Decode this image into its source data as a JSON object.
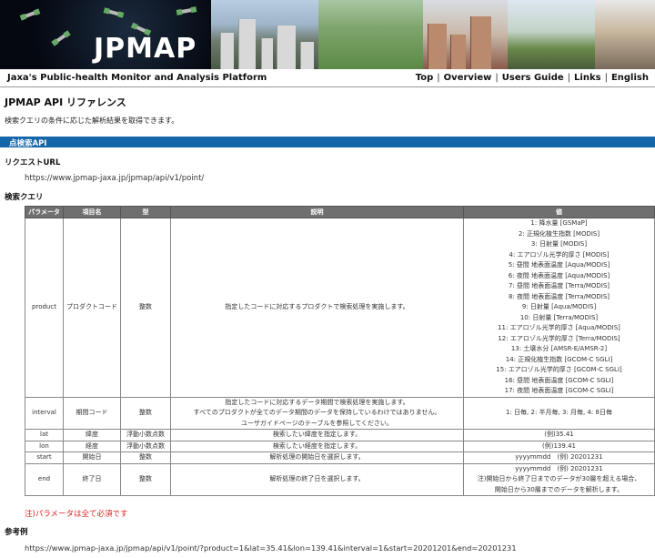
{
  "banner": {
    "logo_text": "JPMAP"
  },
  "header": {
    "subtitle": "Jaxa's Public-health Monitor and Analysis Platform",
    "nav": [
      "Top",
      "Overview",
      "Users Guide",
      "Links",
      "English"
    ]
  },
  "page": {
    "title": "JPMAP API リファレンス",
    "description": "検索クエリの条件に応じた解析結果を取得できます。"
  },
  "section": {
    "title": "点検索API",
    "request_url_heading": "リクエストURL",
    "request_url": "https://www.jpmap-jaxa.jp/jpmap/api/v1/point/",
    "query_heading": "検索クエリ"
  },
  "table": {
    "headers": [
      "パラメータ",
      "項目名",
      "型",
      "説明",
      "値"
    ],
    "product": {
      "param": "product",
      "name": "プロダクトコード",
      "type": "整数",
      "desc": "指定したコードに対応するプロダクトで検索処理を実施します。",
      "values": [
        "1: 降水量 [GSMaP]",
        "2: 正規化植生指数 [MODIS]",
        "3: 日射量 [MODIS]",
        "4: エアロゾル光学的厚さ [MODIS]",
        "5: 昼間 地表面温度 [Aqua/MODIS]",
        "6: 夜間 地表面温度 [Aqua/MODIS]",
        "7: 昼間 地表面温度 [Terra/MODIS]",
        "8: 夜間 地表面温度 [Terra/MODIS]",
        "9: 日射量 [Aqua/MODIS]",
        "10: 日射量 [Terra/MODIS]",
        "11: エアロゾル光学的厚さ [Aqua/MODIS]",
        "12: エアロゾル光学的厚さ [Terra/MODIS]",
        "13: 土壌水分 [AMSR-E/AMSR-2]",
        "14: 正規化植生指数 [GCOM-C SGLI]",
        "15: エアロゾル光学的厚さ [GCOM-C SGLI]",
        "16: 昼間 地表面温度 [GCOM-C SGLI]",
        "17: 夜間 地表面温度 [GCOM-C SGLI]"
      ]
    },
    "interval": {
      "param": "interval",
      "name": "期間コード",
      "type": "整数",
      "desc_lines": [
        "指定したコードに対応するデータ期間で検索処理を実施します。",
        "すべてのプロダクトが全てのデータ期間のデータを保持しているわけではありません。",
        "ユーザガイドページのテーブルを参照してください。"
      ],
      "value": "1: 日毎, 2: 半月毎, 3: 月毎, 4: 8日毎"
    },
    "lat": {
      "param": "lat",
      "name": "緯度",
      "type": "浮動小数点数",
      "desc": "検索したい緯度を指定します。",
      "value": "(例)35.41"
    },
    "lon": {
      "param": "lon",
      "name": "経度",
      "type": "浮動小数点数",
      "desc": "検索したい経度を指定します。",
      "value": "(例)139.41"
    },
    "start": {
      "param": "start",
      "name": "開始日",
      "type": "整数",
      "desc": "解析処理の開始日を選択します。",
      "value": "yyyymmdd　(例) 20201231"
    },
    "end": {
      "param": "end",
      "name": "終了日",
      "type": "整数",
      "desc": "解析処理の終了日を選択します。",
      "value_lines": [
        "yyyymmdd　(例) 20201231",
        "注)開始日から終了日までのデータが30層を超える場合、",
        "開始日から30層までのデータを解析します。"
      ]
    }
  },
  "note": "注)パラメータは全て必須です",
  "example": {
    "heading": "参考例",
    "url": "https://www.jpmap-jaxa.jp/jpmap/api/v1/point/?product=1&lat=35.41&lon=139.41&interval=1&start=20201201&end=20201231"
  }
}
